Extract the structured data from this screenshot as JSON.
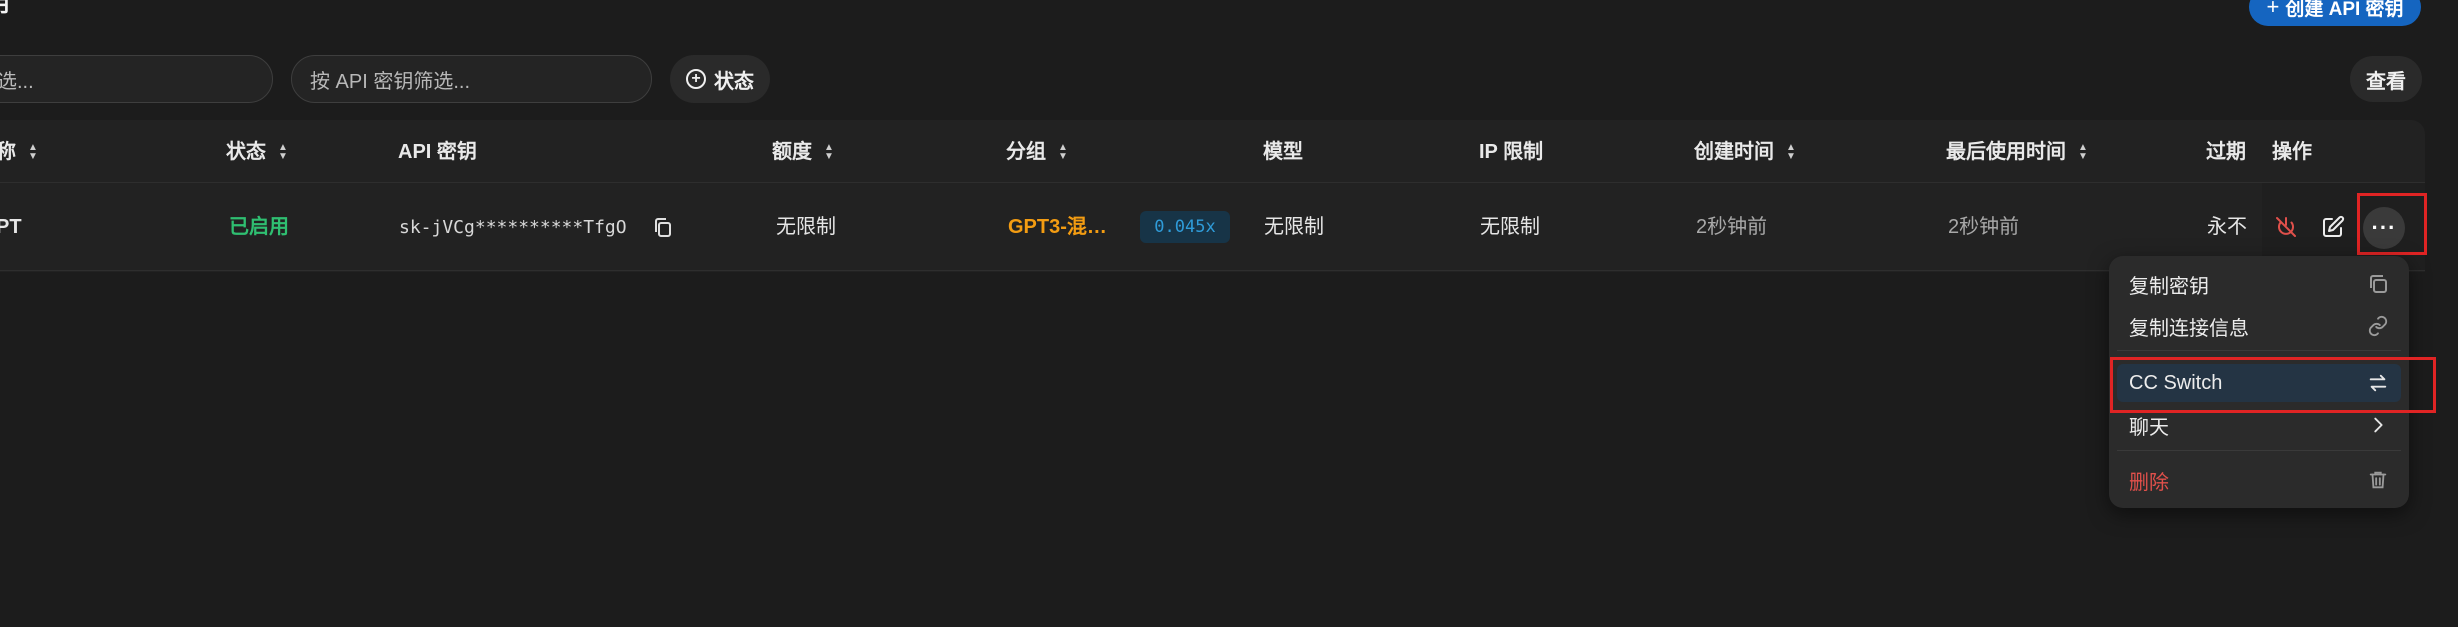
{
  "header": {
    "title": "用",
    "create_button": "创建 API 密钥"
  },
  "filters": {
    "name_placeholder": "筛选...",
    "key_placeholder": "按 API 密钥筛选...",
    "status_button": "状态",
    "view_button": "查看"
  },
  "table": {
    "headers": {
      "name": "称",
      "status": "状态",
      "api_key": "API 密钥",
      "quota": "额度",
      "group": "分组",
      "model": "模型",
      "ip_limit": "IP 限制",
      "created": "创建时间",
      "last_used": "最后使用时间",
      "expire": "过期",
      "actions": "操作"
    },
    "row": {
      "name": "PT",
      "status": "已启用",
      "api_key": "sk-jVCg**********TfgO",
      "quota": "无限制",
      "group": "GPT3-混…",
      "ratio": "0.045x",
      "model": "无限制",
      "ip_limit": "无限制",
      "created": "2秒钟前",
      "last_used": "2秒钟前",
      "expire": "永不"
    }
  },
  "menu": {
    "items": [
      {
        "label": "复制密钥",
        "icon": "copy-icon"
      },
      {
        "label": "复制连接信息",
        "icon": "link-icon"
      },
      {
        "label": "CC Switch",
        "icon": "switch-arrows-icon"
      },
      {
        "label": "聊天",
        "icon": "chevron-right-icon"
      },
      {
        "label": "删除",
        "icon": "trash-icon"
      }
    ]
  },
  "colors": {
    "accent": "#1565c0",
    "enabled": "#2fbf71",
    "group": "#f39c12",
    "ratio": "#2f9bd8",
    "danger": "#e0504b",
    "highlight_box": "#e02424"
  }
}
